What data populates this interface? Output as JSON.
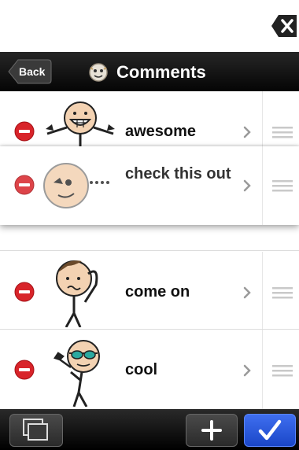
{
  "nav": {
    "back_label": "Back",
    "title": "Comments"
  },
  "comments": [
    {
      "label": "awesome",
      "pictogram": "thumbs-up-grin-figure"
    },
    {
      "label": "check this out",
      "pictogram": "looking-face"
    },
    {
      "label": "come on",
      "pictogram": "head-scratch-figure"
    },
    {
      "label": "cool",
      "pictogram": "sunglasses-figure"
    }
  ],
  "colors": {
    "delete_red": "#d8242a",
    "nav_black": "#111111",
    "done_blue": "#1d4fd6"
  },
  "icons": {
    "close": "backspace-x-icon",
    "delete": "minus-circle-icon",
    "disclosure": "chevron-right-icon",
    "reorder": "reorder-handle-icon",
    "copy": "copy-pages-icon",
    "add": "plus-icon",
    "done": "checkmark-icon"
  }
}
